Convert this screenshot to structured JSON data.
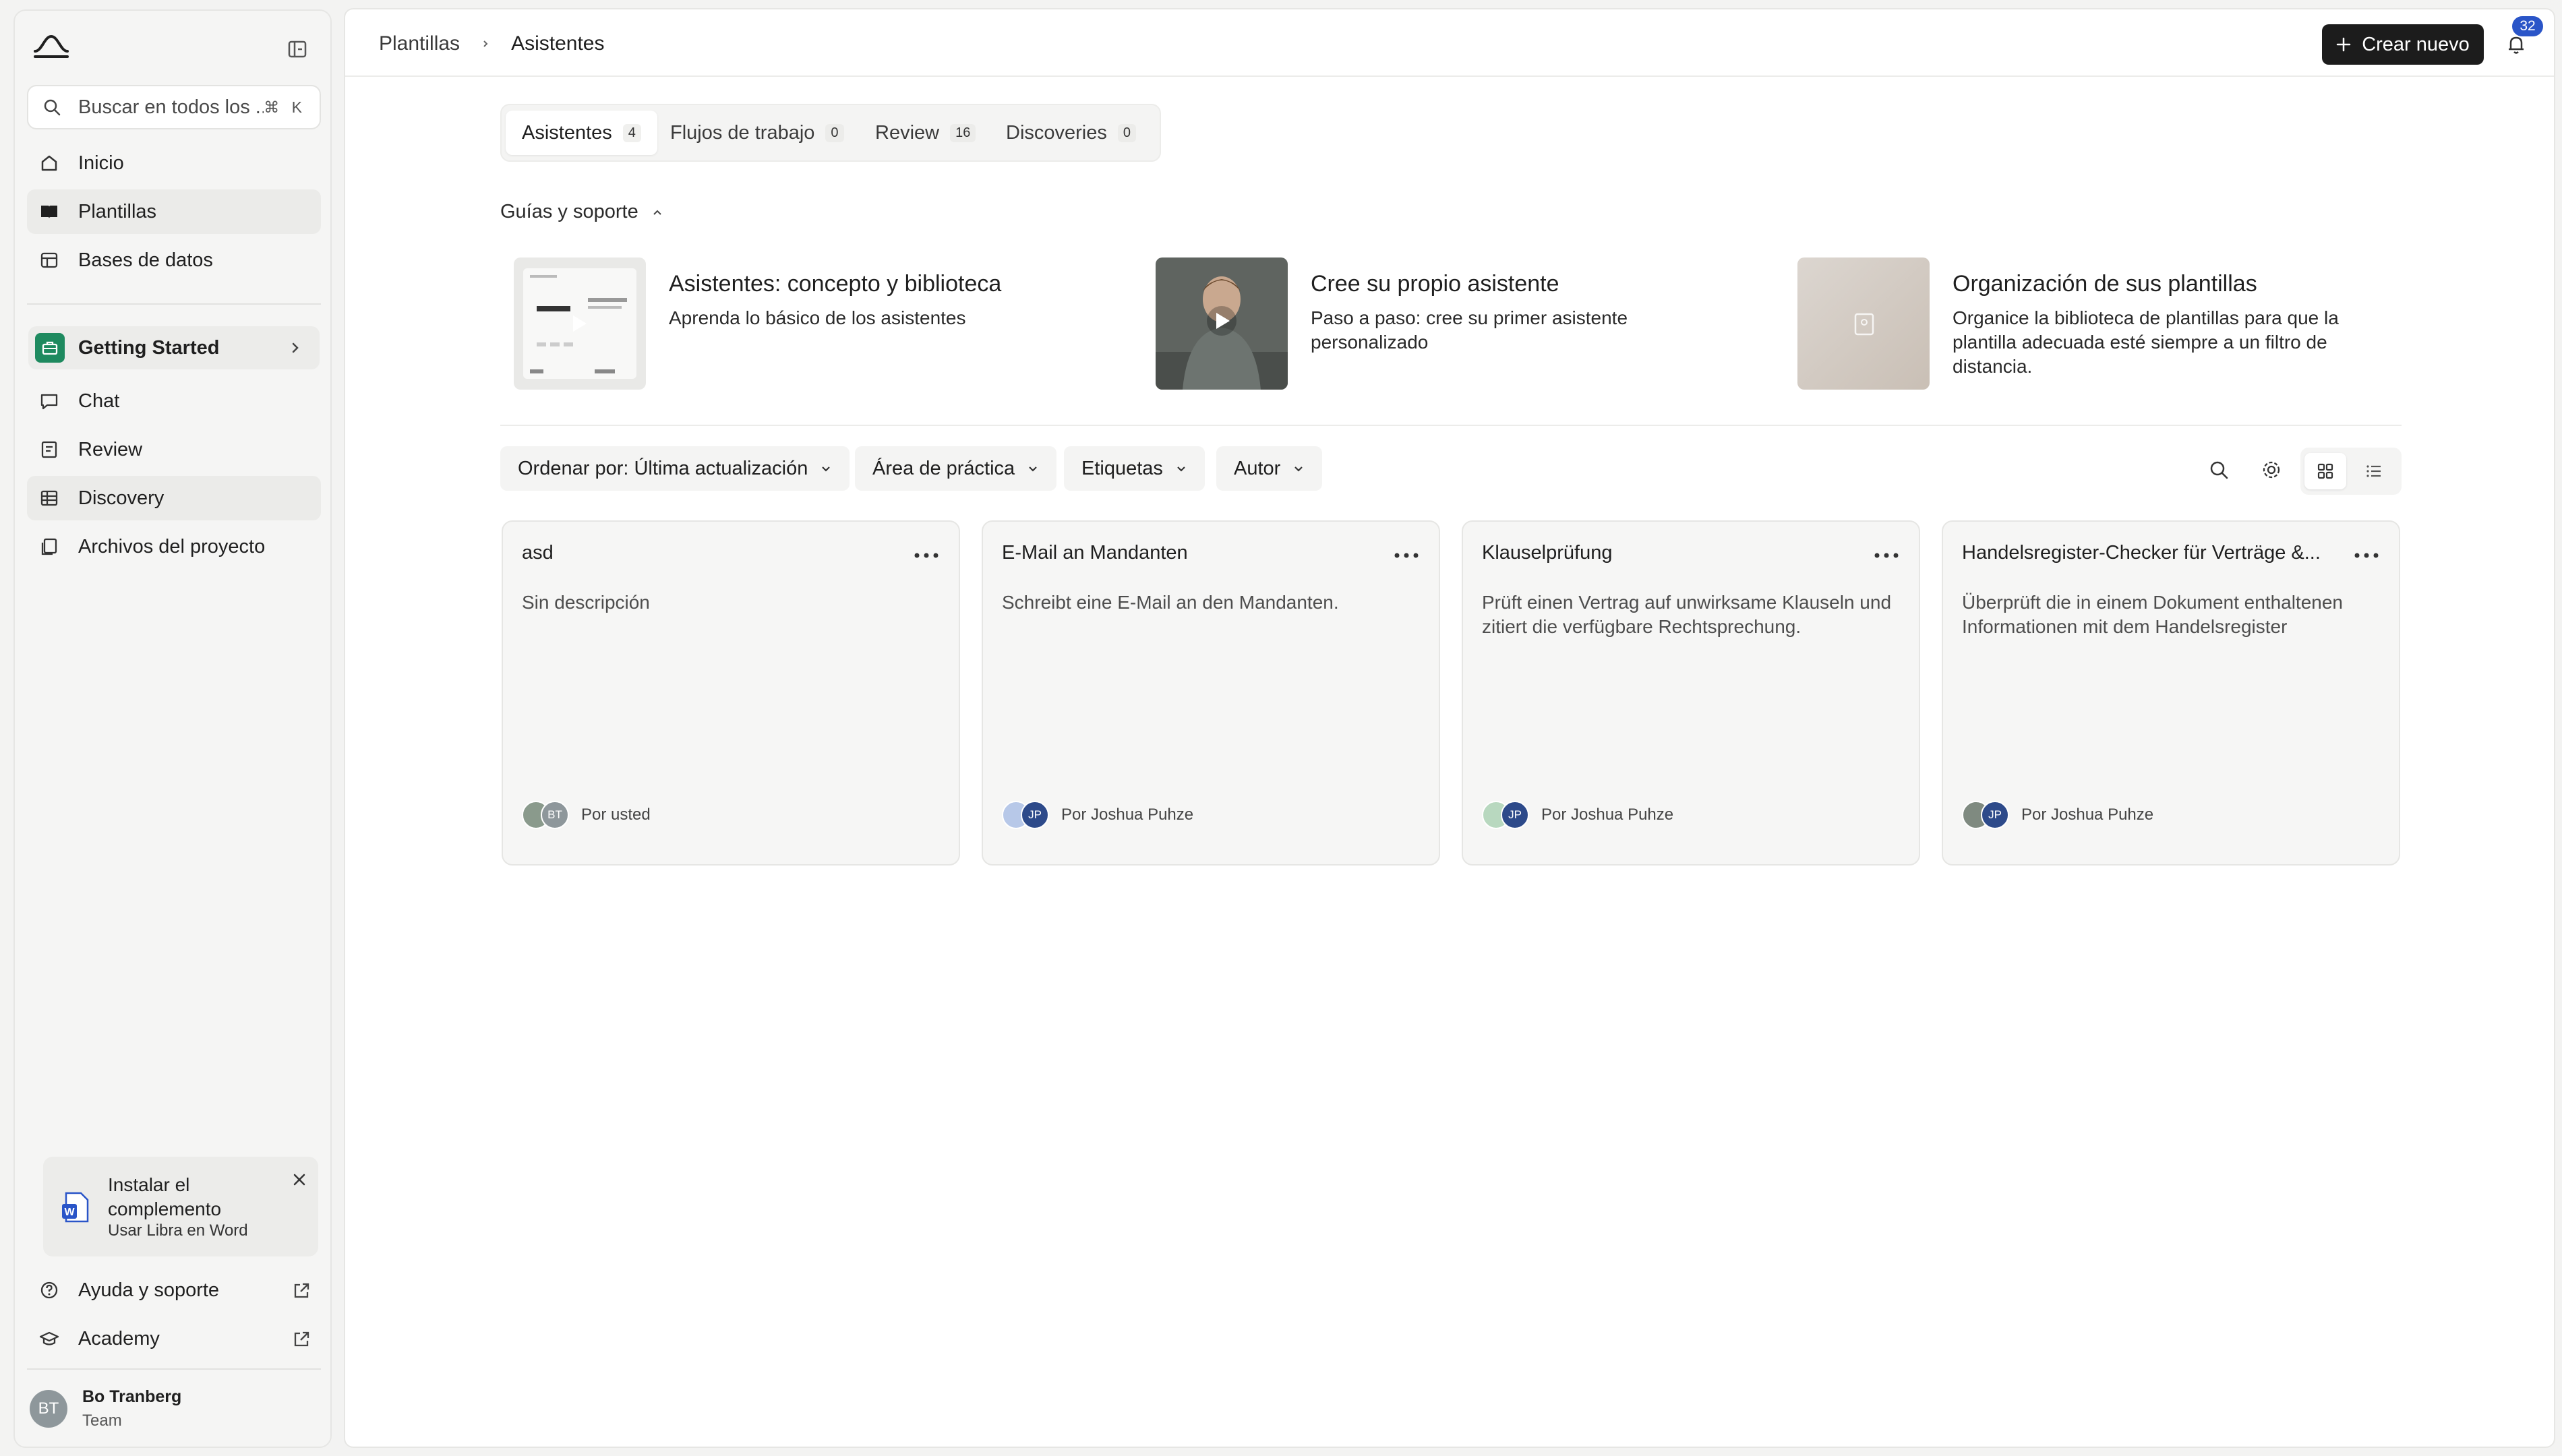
{
  "sidebar": {
    "search": {
      "placeholder": "Buscar en todos los ...",
      "shortcut": "⌘ K"
    },
    "nav": [
      {
        "label": "Inicio",
        "icon": "home-icon"
      },
      {
        "label": "Plantillas",
        "icon": "book-icon",
        "active": true
      },
      {
        "label": "Bases de datos",
        "icon": "database-icon"
      }
    ],
    "project": {
      "label": "Getting Started",
      "icon": "briefcase-icon",
      "color": "#1e8a5f"
    },
    "project_nav": [
      {
        "label": "Chat",
        "icon": "chat-icon"
      },
      {
        "label": "Review",
        "icon": "review-icon"
      },
      {
        "label": "Discovery",
        "icon": "table-icon"
      },
      {
        "label": "Archivos del proyecto",
        "icon": "files-icon"
      }
    ],
    "addin": {
      "title": "Instalar el complemento",
      "subtitle": "Usar Libra en Word"
    },
    "footer": [
      {
        "label": "Ayuda y soporte",
        "icon": "help-icon"
      },
      {
        "label": "Academy",
        "icon": "graduation-icon"
      }
    ],
    "user": {
      "initials": "BT",
      "name": "Bo Tranberg",
      "role": "Team"
    }
  },
  "header": {
    "breadcrumb": [
      "Plantillas",
      "Asistentes"
    ],
    "create_label": "Crear nuevo",
    "notifications": "32"
  },
  "tabs": [
    {
      "label": "Asistentes",
      "count": "4",
      "active": true
    },
    {
      "label": "Flujos de trabajo",
      "count": "0"
    },
    {
      "label": "Review",
      "count": "16"
    },
    {
      "label": "Discoveries",
      "count": "0"
    }
  ],
  "guides": {
    "heading": "Guías y soporte",
    "items": [
      {
        "title": "Asistentes: concepto y biblioteca",
        "desc": "Aprenda lo básico de los asistentes"
      },
      {
        "title": "Cree su propio asistente",
        "desc": "Paso a paso: cree su primer asistente personalizado"
      },
      {
        "title": "Organización de sus plantillas",
        "desc": "Organice la biblioteca de plantillas para que la plantilla adecuada esté siempre a un filtro de distancia."
      }
    ]
  },
  "filters": [
    {
      "label": "Ordenar por: Última actualización"
    },
    {
      "label": "Área de práctica"
    },
    {
      "label": "Etiquetas"
    },
    {
      "label": "Autor"
    }
  ],
  "cards": [
    {
      "title": "asd",
      "desc": "Sin descripción",
      "initials": "BT",
      "author": "Por usted",
      "avatar_color": "#8e979b"
    },
    {
      "title": "E-Mail an Mandanten",
      "desc": "Schreibt eine E-Mail an den Mandanten.",
      "initials": "JP",
      "author": "Por Joshua Puhze",
      "avatar_color": "#2d4a8a"
    },
    {
      "title": "Klauselprüfung",
      "desc": "Prüft einen Vertrag auf unwirksame Klauseln und zitiert die verfügbare Rechtsprechung.",
      "initials": "JP",
      "author": "Por Joshua Puhze",
      "avatar_color": "#2d4a8a"
    },
    {
      "title": "Handelsregister-Checker für Verträge &...",
      "desc": "Überprüft die in einem Dokument enthaltenen Informationen mit dem Handelsregister",
      "initials": "JP",
      "author": "Por Joshua Puhze",
      "avatar_color": "#2d4a8a"
    }
  ]
}
